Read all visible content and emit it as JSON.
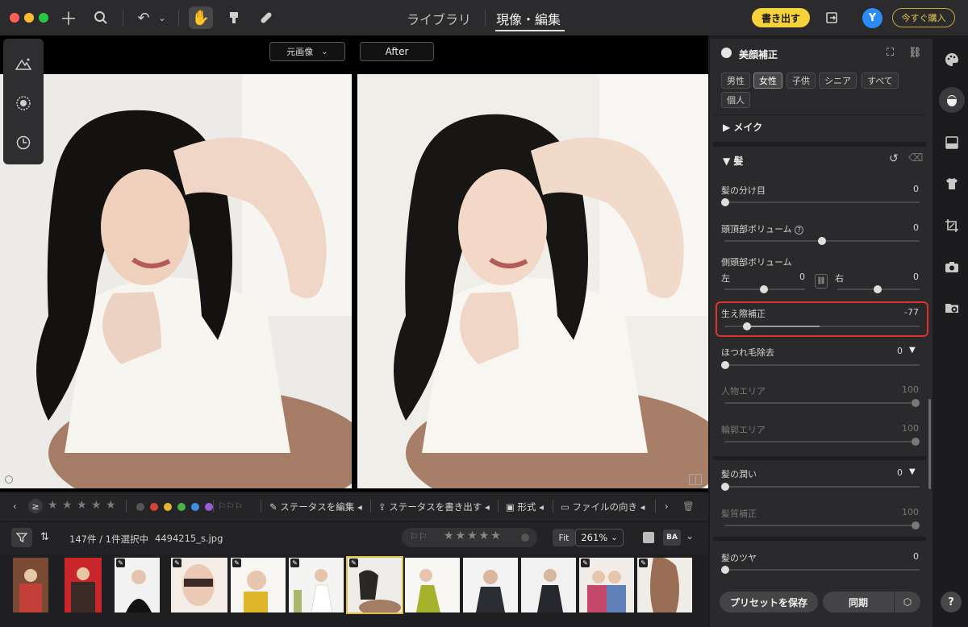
{
  "toolbar": {
    "tabs": [
      {
        "label": "ライブラリ"
      },
      {
        "label": "現像・編集"
      }
    ],
    "export_label": "書き出す",
    "avatar_letter": "Y",
    "buy_label": "今すぐ購入",
    "colors": {
      "accent": "#f5d23b",
      "avatar": "#2a8cf7"
    }
  },
  "viewer": {
    "before_select": "元画像",
    "after_label": "After"
  },
  "strip": {
    "rating_operator": "≥",
    "edit_status": "ステータスを編集",
    "export_status": "ステータスを書き出す",
    "format": "形式",
    "orientation": "ファイルの向き",
    "color_labels": [
      "#d2433b",
      "#e5b530",
      "#4ab04a",
      "#3e8ee8",
      "#9c5ad6"
    ]
  },
  "film_info": {
    "count": "147件 / 1件選択中",
    "filename": "4494215_s.jpg",
    "fit_label": "Fit",
    "zoom": "261%",
    "compare_label": "BA"
  },
  "panel": {
    "title": "美顔補正",
    "gender_tabs": [
      "男性",
      "女性",
      "子供",
      "シニア",
      "すべて",
      "個人"
    ],
    "active_tab": "女性",
    "makeup_label": "メイク",
    "hair_label": "髪",
    "sliders": {
      "part": {
        "label": "髪の分け目",
        "value": "0",
        "level": 0
      },
      "crown": {
        "label": "頭頂部ボリューム",
        "value": "0",
        "level": 0.5
      },
      "side": {
        "label": "側頭部ボリューム",
        "left_label": "左",
        "left_value": "0",
        "right_label": "右",
        "right_value": "0",
        "level": 0.5
      },
      "hairline": {
        "label": "生え際補正",
        "value": "-77",
        "level": 0.115
      },
      "flyaway": {
        "label": "ほつれ毛除去",
        "value": "0",
        "level": 0
      },
      "person_area": {
        "label": "人物エリア",
        "value": "100",
        "level": 1
      },
      "outline_area": {
        "label": "輪郭エリア",
        "value": "100",
        "level": 1
      },
      "moisture": {
        "label": "髪の潤い",
        "value": "0",
        "level": 0
      },
      "texture": {
        "label": "髪質補正",
        "value": "100",
        "level": 1
      },
      "shine": {
        "label": "髪のツヤ",
        "value": "0",
        "level": 0
      }
    },
    "preset_label": "プリセットを保存",
    "sync_label": "同期"
  },
  "rail": {
    "icons": [
      "palette-icon",
      "face-icon",
      "gradient-icon",
      "shirt-icon",
      "crop-icon",
      "camera-icon",
      "folder-eye-icon"
    ],
    "help_label": "?"
  }
}
